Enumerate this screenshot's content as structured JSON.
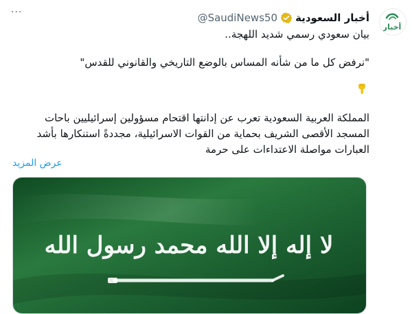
{
  "tweet": {
    "author_name": "أخبار السعودية",
    "handle": "@SaudiNews50",
    "more_label": "···",
    "line1": "بيان سعودي رسمي شديد اللهجة..",
    "quote": "\"نرفض كل ما من شأنه المساس بالوضع التاريخي والقانوني للقدس\"",
    "paragraph": "المملكة العربية السعودية تعرب عن إدانتها اقتحام مسؤولين إسرائيليين باحات المسجد الأقصى الشريف بحماية من القوات الاسرائيلية، مجددةً استنكارها بأشد العبارات مواصلة الاعتداءات على حرمة",
    "show_more": "عرض المزيد",
    "avatar_text": "أخبار",
    "emoji": "pointing-down",
    "flag_text": "لا إله إلا الله محمد رسول الله"
  },
  "colors": {
    "accent": "#1d9bf0",
    "verified_gold": "#e2b719",
    "flag_green": "#1f6b34",
    "avatar_green": "#2e8b57"
  }
}
